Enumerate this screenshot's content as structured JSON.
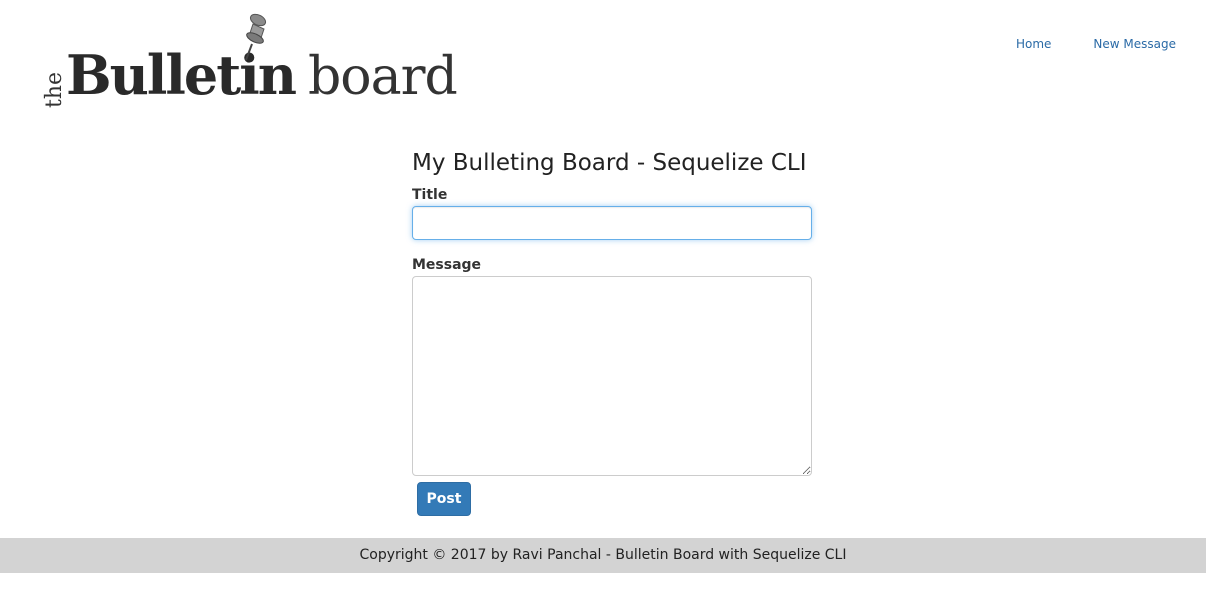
{
  "logo": {
    "the": "the",
    "bulletin": "Bulletin",
    "board": "board"
  },
  "nav": {
    "items": [
      {
        "label": "Home"
      },
      {
        "label": "New Message"
      }
    ]
  },
  "main": {
    "title": "My Bulleting Board - Sequelize CLI",
    "form": {
      "title_label": "Title",
      "title_value": "",
      "message_label": "Message",
      "message_value": "",
      "post_label": "Post"
    }
  },
  "footer": {
    "text": "Copyright © 2017 by Ravi Panchal - Bulletin Board with Sequelize CLI"
  },
  "colors": {
    "link": "#2a6aa6",
    "primary_button": "#337ab7",
    "footer_bg": "#d3d3d3",
    "focus_border": "#66afe9"
  }
}
